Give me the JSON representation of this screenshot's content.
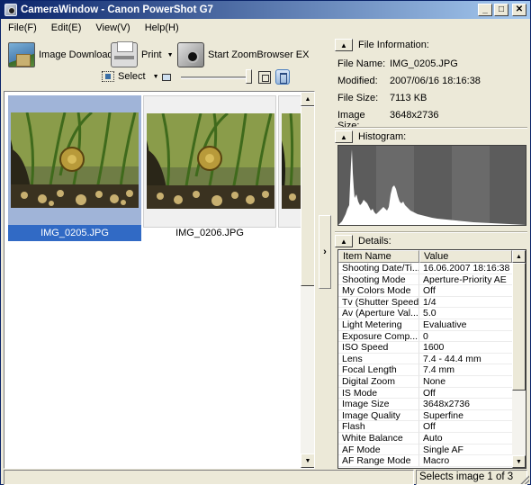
{
  "window": {
    "title": "CameraWindow - Canon PowerShot G7",
    "controls": [
      "minimize",
      "maximize",
      "close"
    ]
  },
  "menu": [
    "File(F)",
    "Edit(E)",
    "View(V)",
    "Help(H)"
  ],
  "toolbar": {
    "image_download": "Image Download",
    "print": "Print",
    "zoombrowser": "Start ZoomBrowser EX",
    "select": "Select"
  },
  "thumbnails": [
    {
      "filename": "IMG_0205.JPG",
      "selected": true
    },
    {
      "filename": "IMG_0206.JPG",
      "selected": false
    }
  ],
  "file_info": {
    "header": "File Information:",
    "rows": [
      {
        "label": "File Name:",
        "value": "IMG_0205.JPG"
      },
      {
        "label": "Modified:",
        "value": "2007/06/16 18:16:38"
      },
      {
        "label": "File Size:",
        "value": "7113 KB"
      },
      {
        "label": "Image Size:",
        "value": "3648x2736"
      }
    ]
  },
  "histogram": {
    "header": "Histogram:"
  },
  "details": {
    "header": "Details:",
    "columns": [
      "Item Name",
      "Value"
    ],
    "rows": [
      {
        "name": "Shooting Date/Ti...",
        "value": "16.06.2007 18:16:38"
      },
      {
        "name": "Shooting Mode",
        "value": "Aperture-Priority AE"
      },
      {
        "name": "My Colors Mode",
        "value": "Off"
      },
      {
        "name": "Tv (Shutter Speed)",
        "value": "1/4"
      },
      {
        "name": "Av (Aperture Val...",
        "value": "5.0"
      },
      {
        "name": "Light Metering",
        "value": "Evaluative"
      },
      {
        "name": "Exposure Comp...",
        "value": "0"
      },
      {
        "name": "ISO Speed",
        "value": "1600"
      },
      {
        "name": "Lens",
        "value": "7.4 - 44.4 mm"
      },
      {
        "name": "Focal Length",
        "value": "7.4 mm"
      },
      {
        "name": "Digital Zoom",
        "value": "None"
      },
      {
        "name": "IS Mode",
        "value": "Off"
      },
      {
        "name": "Image Size",
        "value": "3648x2736"
      },
      {
        "name": "Image Quality",
        "value": "Superfine"
      },
      {
        "name": "Flash",
        "value": "Off"
      },
      {
        "name": "White Balance",
        "value": "Auto"
      },
      {
        "name": "AF Mode",
        "value": "Single AF"
      },
      {
        "name": "AF Range Mode",
        "value": "Macro"
      }
    ]
  },
  "status": {
    "text": "Selects image 1 of 3"
  },
  "colors": {
    "title_gradient_start": "#0a246a",
    "title_gradient_end": "#a6caf0",
    "selection": "#316ac5",
    "face": "#ece9d8"
  }
}
